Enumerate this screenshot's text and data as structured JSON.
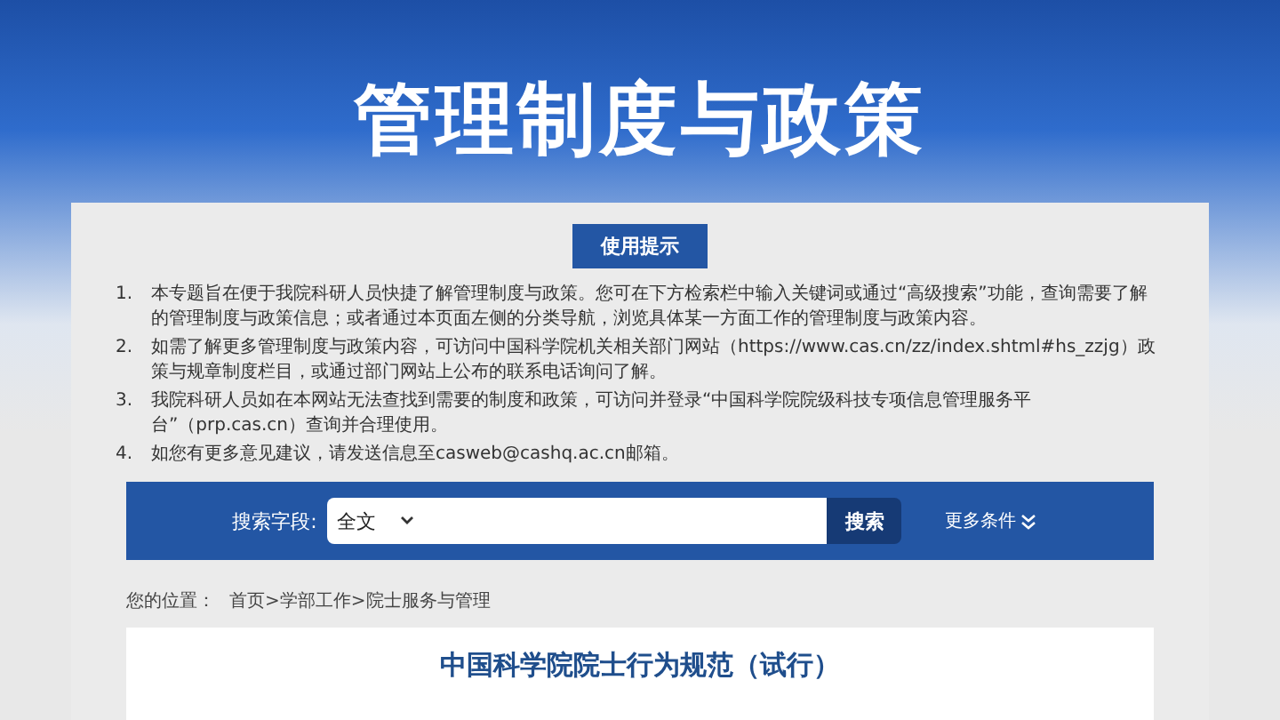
{
  "page_title": "管理制度与政策",
  "tips": {
    "heading": "使用提示",
    "items": [
      {
        "number": "1.",
        "text": "本专题旨在便于我院科研人员快捷了解管理制度与政策。您可在下方检索栏中输入关键词或通过“高级搜索”功能，查询需要了解的管理制度与政策信息；或者通过本页面左侧的分类导航，浏览具体某一方面工作的管理制度与政策内容。"
      },
      {
        "number": "2.",
        "text": "如需了解更多管理制度与政策内容，可访问中国科学院机关相关部门网站（https://www.cas.cn/zz/index.shtml#hs_zzjg）政策与规章制度栏目，或通过部门网站上公布的联系电话询问了解。"
      },
      {
        "number": "3.",
        "text": "我院科研人员如在本网站无法查找到需要的制度和政策，可访问并登录“中国科学院院级科技专项信息管理服务平台”（prp.cas.cn）查询并合理使用。"
      },
      {
        "number": "4.",
        "text": "如您有更多意见建议，请发送信息至casweb@cashq.ac.cn邮箱。"
      }
    ]
  },
  "search": {
    "label": "搜索字段:",
    "field": "全文",
    "button": "搜索",
    "more": "更多条件"
  },
  "breadcrumb": {
    "label": "您的位置：",
    "path": "首页>学部工作>院士服务与管理"
  },
  "article": {
    "title": "中国科学院院士行为规范（试行）"
  }
}
